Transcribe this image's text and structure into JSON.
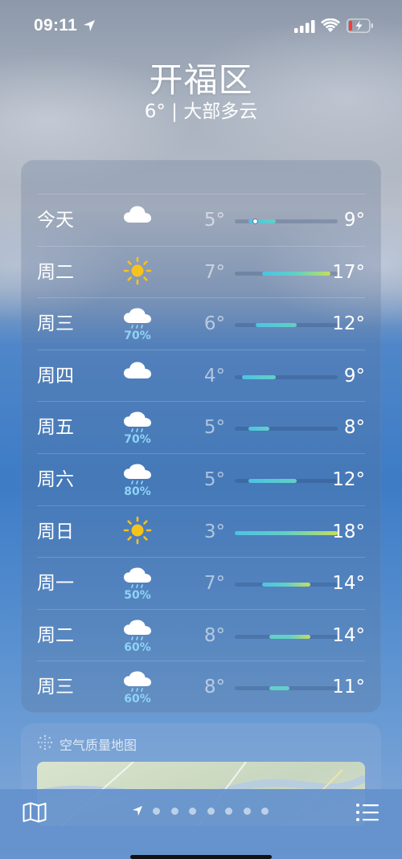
{
  "status_bar": {
    "time": "09:11"
  },
  "header": {
    "city": "开福区",
    "summary": "6° | 大部多云"
  },
  "forecast": [
    {
      "day": "今天",
      "icon": "cloud-icon",
      "precip": "",
      "low": "5°",
      "high": "9°",
      "range": [
        5,
        9
      ],
      "current": 6
    },
    {
      "day": "周二",
      "icon": "sun-icon",
      "precip": "",
      "low": "7°",
      "high": "17°",
      "range": [
        7,
        17
      ]
    },
    {
      "day": "周三",
      "icon": "rain-cloud-icon",
      "precip": "70%",
      "low": "6°",
      "high": "12°",
      "range": [
        6,
        12
      ]
    },
    {
      "day": "周四",
      "icon": "cloud-icon",
      "precip": "",
      "low": "4°",
      "high": "9°",
      "range": [
        4,
        9
      ]
    },
    {
      "day": "周五",
      "icon": "rain-cloud-icon",
      "precip": "70%",
      "low": "5°",
      "high": "8°",
      "range": [
        5,
        8
      ]
    },
    {
      "day": "周六",
      "icon": "rain-cloud-icon",
      "precip": "80%",
      "low": "5°",
      "high": "12°",
      "range": [
        5,
        12
      ]
    },
    {
      "day": "周日",
      "icon": "sun-icon",
      "precip": "",
      "low": "3°",
      "high": "18°",
      "range": [
        3,
        18
      ]
    },
    {
      "day": "周一",
      "icon": "rain-cloud-icon",
      "precip": "50%",
      "low": "7°",
      "high": "14°",
      "range": [
        7,
        14
      ]
    },
    {
      "day": "周二",
      "icon": "rain-cloud-icon",
      "precip": "60%",
      "low": "8°",
      "high": "14°",
      "range": [
        8,
        14
      ]
    },
    {
      "day": "周三",
      "icon": "rain-cloud-icon",
      "precip": "60%",
      "low": "8°",
      "high": "11°",
      "range": [
        8,
        11
      ]
    }
  ],
  "temp_scale": {
    "min": 3,
    "max": 18
  },
  "air_quality": {
    "title": "空气质量地图"
  },
  "bottom_bar": {
    "page_count": 7,
    "active_page": "current-location"
  },
  "colors": {
    "cool": "#4cc3e2",
    "mild": "#62d0c4",
    "warm": "#c4dd5e",
    "rain_pct": "#8fd3f6",
    "sun": "#f7c21b"
  }
}
